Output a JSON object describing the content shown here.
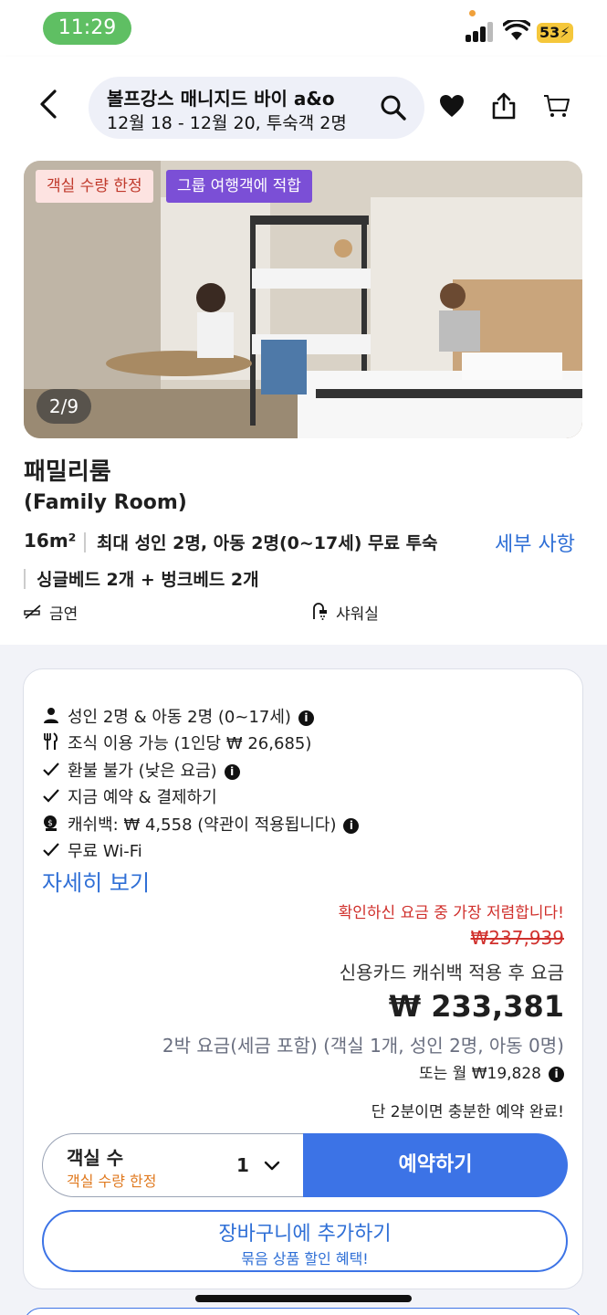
{
  "status_bar": {
    "time": "11:29",
    "battery": "53"
  },
  "header": {
    "title": "볼프강스 매니지드 바이 a&o",
    "subtitle": "12월 18 - 12월 20, 투숙객 2명"
  },
  "room": {
    "badges": [
      "객실 수량 한정",
      "그룹 여행객에 적합"
    ],
    "photo_counter": "2/9",
    "name": "패밀리룸",
    "name_en": "(Family Room)",
    "size": "16m²",
    "occupancy": "최대 성인 2명, 아동 2명(0~17세) 무료 투숙",
    "details_link": "세부 사항",
    "beds": "싱글베드 2개 + 벙크베드 2개",
    "amenities": [
      "금연",
      "샤워실"
    ]
  },
  "offer": {
    "features": [
      {
        "icon": "person-icon",
        "text": "성인 2명 & 아동 2명 (0~17세)"
      },
      {
        "icon": "dining-icon",
        "text": "조식 이용 가능 (1인당 ₩ 26,685)"
      },
      {
        "icon": "check-icon",
        "text": "환불 불가 (낮은 요금)"
      },
      {
        "icon": "check-icon",
        "text": "지금 예약 & 결제하기"
      },
      {
        "icon": "cashback-icon",
        "text": "캐쉬백: ₩ 4,558 (약관이 적용됩니다)"
      },
      {
        "icon": "check-icon",
        "text": "무료 Wi-Fi"
      }
    ],
    "more_link": "자세히 보기",
    "cheapest_note": "확인하신 요금 중 가장 저렴합니다!",
    "old_price": "₩237,939",
    "cashback_price_note": "신용카드 캐쉬백 적용 후 요금",
    "price": "₩ 233,381",
    "nights_note": "2박 요금(세금 포함) (객실 1개, 성인 2명, 아동 0명)",
    "monthly": "또는 월 ₩19,828",
    "quick_note": "단 2분이면 충분한 예약 완료!",
    "room_select_label": "객실 수",
    "room_select_sub": "객실 수량 한정",
    "room_qty": "1",
    "book_label": "예약하기",
    "cart_label": "장바구니에 추가하기",
    "cart_sub": "묶음 상품 할인 혜택!"
  },
  "colors": {
    "accent": "#3c73e6",
    "alert": "#d0302c",
    "time_pill": "#5fbf63"
  }
}
